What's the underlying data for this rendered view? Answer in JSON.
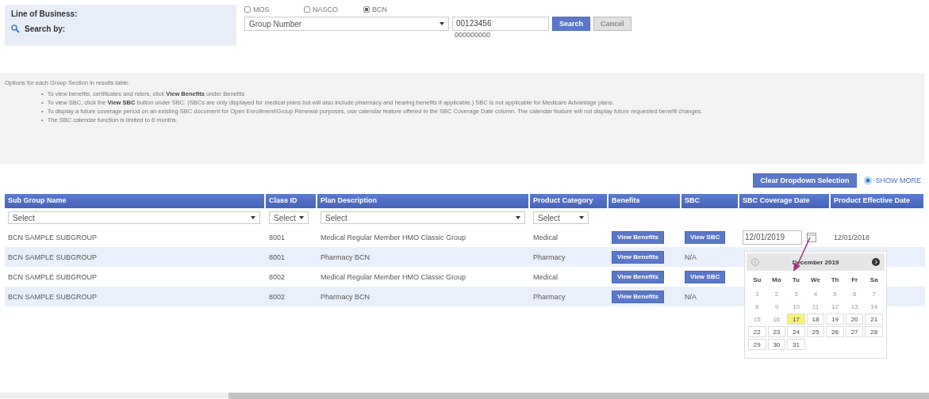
{
  "search_panel": {
    "line_of_business_label": "Line of Business:",
    "search_by_label": "Search by:",
    "line_of_business": [
      {
        "label": "MOS",
        "selected": false
      },
      {
        "label": "NASCO",
        "selected": false
      },
      {
        "label": "BCN",
        "selected": true
      }
    ],
    "search_type": "Group Number",
    "search_value": "00123456",
    "search_hint": "000000000",
    "buttons": [
      "Search",
      "Cancel"
    ]
  },
  "instructions": {
    "title": "Options for each Group Section in results table:",
    "bullet": "•",
    "items": [
      "To view benefits, certificates and riders, click **View Benefits** under Benefits",
      "To view SBC, click the **View SBC** button under SBC. (SBCs are only displayed for medical plans but will also include pharmacy and hearing benefits if applicable.) SBC is not applicable for Medicare Advantage plans.",
      "To display a future coverage period on an existing SBC document for Open Enrollment/Group Renewal purposes, use calendar feature offered in the SBC Coverage Date column. The calendar feature will not display future requested benefit changes.",
      "The SBC calendar function is limited to 6 months."
    ]
  },
  "toolbar": {
    "clear_button": "Clear Dropdown Selection",
    "show_more": "SHOW MORE"
  },
  "table": {
    "columns": [
      "Sub Group Name",
      "Class ID",
      "Plan Description",
      "Product Category",
      "Benefits",
      "SBC",
      "SBC Coverage Date",
      "Product Effective Date"
    ],
    "filters": [
      "Select",
      "Select",
      "Select",
      "Select"
    ],
    "rows": [
      {
        "sub_group": "BCN SAMPLE SUBGROUP",
        "class_id": "8001",
        "plan": "Medical Regular Member HMO Classic Group",
        "category": "Medical",
        "benefits": "View Benefits",
        "sbc": {
          "kind": "button",
          "label": "View SBC"
        },
        "coverage_date": "12/01/2019",
        "effective_date": "12/01/2018"
      },
      {
        "sub_group": "BCN SAMPLE SUBGROUP",
        "class_id": "8001",
        "plan": "Pharmacy BCN",
        "category": "Pharmacy",
        "benefits": "View Benefits",
        "sbc": {
          "kind": "text",
          "label": "N/A"
        }
      },
      {
        "sub_group": "BCN SAMPLE SUBGROUP",
        "class_id": "8002",
        "plan": "Medical Regular Member HMO Classic Group",
        "category": "Medical",
        "benefits": "View Benefits",
        "sbc": {
          "kind": "button",
          "label": "View SBC"
        }
      },
      {
        "sub_group": "BCN SAMPLE SUBGROUP",
        "class_id": "8002",
        "plan": "Pharmacy BCN",
        "category": "Pharmacy",
        "benefits": "View Benefits",
        "sbc": {
          "kind": "text",
          "label": "N/A"
        }
      }
    ]
  },
  "calendar": {
    "month": "December 2019",
    "weekdays": [
      "Su",
      "Mo",
      "Tu",
      "We",
      "Th",
      "Fr",
      "Sa"
    ],
    "weeks": [
      [
        {
          "label": "1",
          "disabled": true,
          "selected": false
        },
        {
          "label": "2",
          "disabled": true,
          "selected": false
        },
        {
          "label": "3",
          "disabled": true,
          "selected": false
        },
        {
          "label": "4",
          "disabled": true,
          "selected": false
        },
        {
          "label": "5",
          "disabled": true,
          "selected": false
        },
        {
          "label": "6",
          "disabled": true,
          "selected": false
        },
        {
          "label": "7",
          "disabled": true,
          "selected": false
        }
      ],
      [
        {
          "label": "8",
          "disabled": true,
          "selected": false
        },
        {
          "label": "9",
          "disabled": true,
          "selected": false
        },
        {
          "label": "10",
          "disabled": true,
          "selected": false
        },
        {
          "label": "11",
          "disabled": true,
          "selected": false
        },
        {
          "label": "12",
          "disabled": true,
          "selected": false
        },
        {
          "label": "13",
          "disabled": true,
          "selected": false
        },
        {
          "label": "14",
          "disabled": true,
          "selected": false
        }
      ],
      [
        {
          "label": "15",
          "disabled": true,
          "selected": false
        },
        {
          "label": "16",
          "disabled": true,
          "selected": false
        },
        {
          "label": "17",
          "disabled": false,
          "selected": true
        },
        {
          "label": "18",
          "disabled": false,
          "selected": false
        },
        {
          "label": "19",
          "disabled": false,
          "selected": false
        },
        {
          "label": "20",
          "disabled": false,
          "selected": false
        },
        {
          "label": "21",
          "disabled": false,
          "selected": false
        }
      ],
      [
        {
          "label": "22",
          "disabled": false,
          "selected": false
        },
        {
          "label": "23",
          "disabled": false,
          "selected": false
        },
        {
          "label": "24",
          "disabled": false,
          "selected": false
        },
        {
          "label": "25",
          "disabled": false,
          "selected": false
        },
        {
          "label": "26",
          "disabled": false,
          "selected": false
        },
        {
          "label": "27",
          "disabled": false,
          "selected": false
        },
        {
          "label": "28",
          "disabled": false,
          "selected": false
        }
      ],
      [
        {
          "label": "29",
          "disabled": false,
          "selected": false
        },
        {
          "label": "30",
          "disabled": false,
          "selected": false
        },
        {
          "label": "31",
          "disabled": false,
          "selected": false
        }
      ]
    ]
  }
}
